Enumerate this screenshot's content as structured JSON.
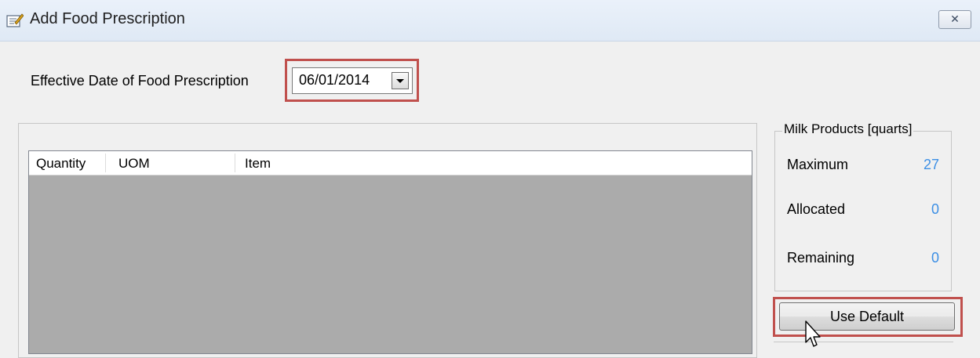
{
  "window": {
    "title": "Add Food Prescription",
    "close_glyph": "✕",
    "title_icon": "prescription-pad-icon"
  },
  "effective_date": {
    "label": "Effective Date of Food Prescription",
    "value": "06/01/2014",
    "dropdown_icon": "chevron-down-icon"
  },
  "items_list": {
    "columns": [
      "Quantity",
      "UOM",
      "Item"
    ],
    "rows": []
  },
  "milk_products": {
    "title": "Milk Products [quarts]",
    "rows": [
      {
        "label": "Maximum",
        "value": "27"
      },
      {
        "label": "Allocated",
        "value": "0"
      },
      {
        "label": "Remaining",
        "value": "0"
      }
    ]
  },
  "buttons": {
    "use_default": "Use Default"
  },
  "colors": {
    "highlight": "#c0504d",
    "value_blue": "#3c8fe5",
    "list_background": "#ababab",
    "window_background": "#f0f0f0"
  }
}
